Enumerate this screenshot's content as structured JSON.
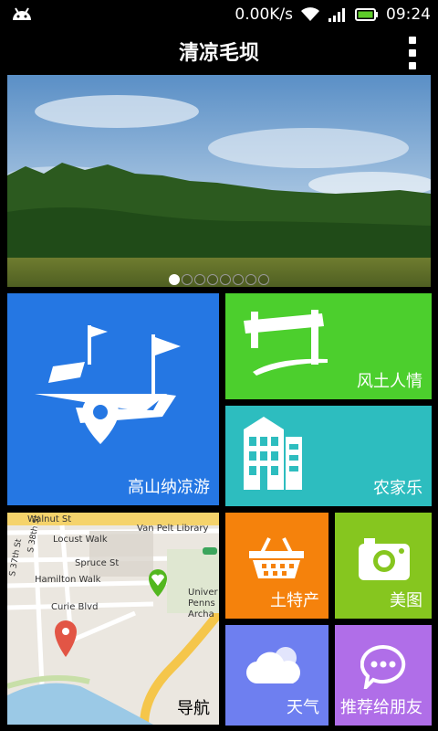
{
  "status_bar": {
    "network_speed": "0.00K/s",
    "time": "09:24",
    "icons": [
      "android-icon",
      "wifi-icon",
      "signal-icon",
      "battery-icon"
    ]
  },
  "header": {
    "title": "清凉毛坝",
    "menu_icon": "overflow-menu-icon"
  },
  "banner": {
    "dot_count": 8,
    "active_index": 0
  },
  "tiles": {
    "gaoshan": {
      "label": "高山纳凉游",
      "icon": "route-flags-pin-icon",
      "color": "#2577e3"
    },
    "fengtu": {
      "label": "风土人情",
      "icon": "archway-icon",
      "color": "#4ccf2d"
    },
    "nongjia": {
      "label": "农家乐",
      "icon": "buildings-icon",
      "color": "#2dbdbf"
    },
    "map": {
      "label": "导航",
      "streets": [
        "Walnut St",
        "Locust Walk",
        "Spruce St",
        "Hamilton Walk",
        "Curie Blvd",
        "S 38th St",
        "S 37th St"
      ],
      "places": [
        "Van Pelt Library",
        "Univer",
        "Penns",
        "Archa"
      ]
    },
    "tuchan": {
      "label": "土特产",
      "icon": "basket-icon",
      "color": "#f5820c"
    },
    "meitu": {
      "label": "美图",
      "icon": "camera-icon",
      "color": "#86c61f"
    },
    "tianqi": {
      "label": "天气",
      "icon": "cloud-icon",
      "color": "#6e7ff0"
    },
    "tuijian": {
      "label": "推荐给朋友",
      "icon": "chat-bubble-icon",
      "color": "#b06ee8"
    }
  }
}
